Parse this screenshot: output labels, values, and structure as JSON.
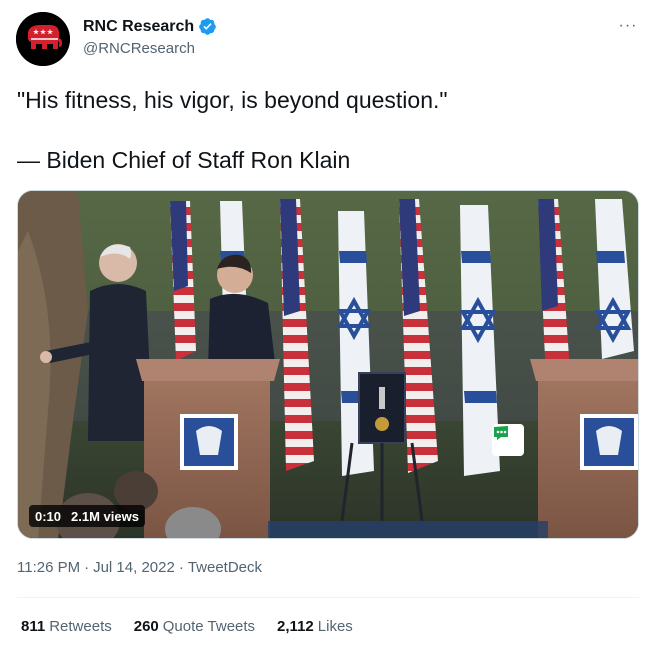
{
  "author": {
    "display_name": "RNC Research",
    "handle": "@RNCResearch",
    "avatar_icon": "republican-elephant-icon",
    "verified_icon": "verified-badge-icon",
    "verified_color": "#1d9bf0"
  },
  "more_icon": "more-dots-icon",
  "more_label": "···",
  "tweet": {
    "line1": "\"His fitness, his vigor, is beyond question.\"",
    "line2": "— Biden Chief of Staff Ron Klain"
  },
  "media": {
    "duration": "0:10",
    "views": "2.1M views",
    "gif_icon": "video-badge-icon"
  },
  "meta": {
    "time": "11:26 PM",
    "separator1": "·",
    "date": "Jul 14, 2022",
    "separator2": "·",
    "source": "TweetDeck"
  },
  "stats": [
    {
      "value": "811",
      "label": "Retweets"
    },
    {
      "value": "260",
      "label": "Quote Tweets"
    },
    {
      "value": "2,112",
      "label": "Likes"
    }
  ],
  "colors": {
    "text_primary": "#0f1419",
    "text_secondary": "#536471",
    "divider": "#eff3f4",
    "avatar_red": "#d3202c"
  }
}
